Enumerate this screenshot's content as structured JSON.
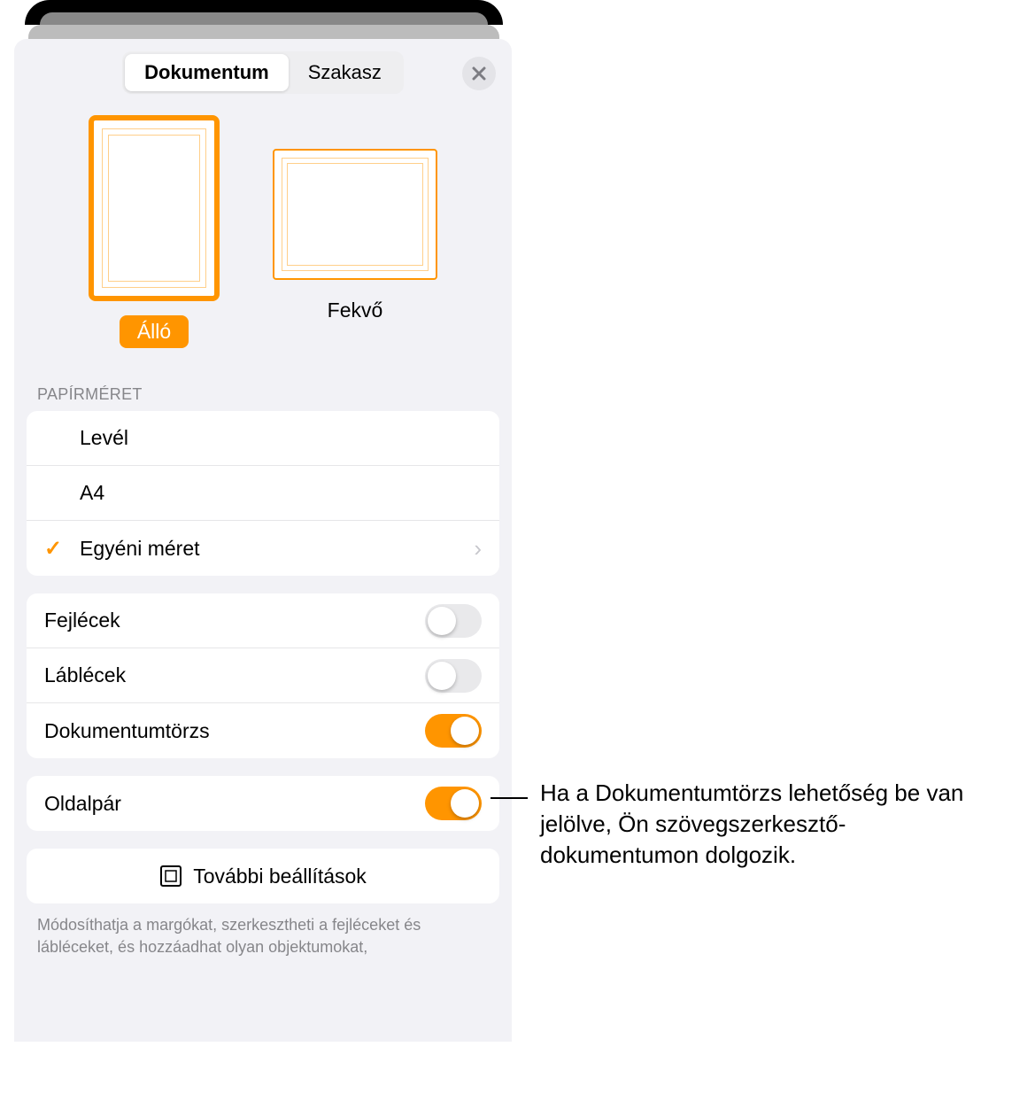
{
  "tabs": {
    "document": "Dokumentum",
    "section": "Szakasz"
  },
  "orientation": {
    "portrait": "Álló",
    "landscape": "Fekvő"
  },
  "paper_size_header": "Papírméret",
  "paper_sizes": {
    "letter": "Levél",
    "a4": "A4",
    "custom": "Egyéni méret"
  },
  "toggles": {
    "headers": "Fejlécek",
    "footers": "Láblécek",
    "body": "Dokumentumtörzs",
    "facing": "Oldalpár"
  },
  "more_settings": "További beállítások",
  "footer_note": "Módosíthatja a margókat, szerkesztheti a fejléceket és lábléceket, és hozzáadhat olyan objektumokat,",
  "callout": "Ha a Dokumentumtörzs lehetőség be van jelölve, Ön szövegszerkesztő-dokumentumon dolgozik."
}
